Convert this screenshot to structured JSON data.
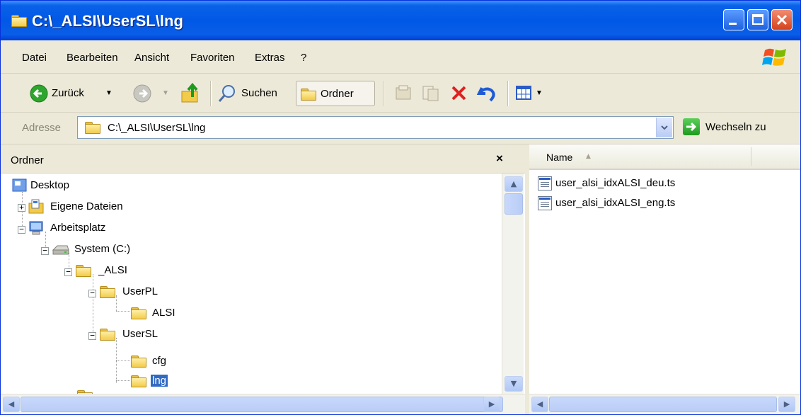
{
  "window": {
    "title": "C:\\_ALSI\\UserSL\\lng"
  },
  "menu": {
    "items": [
      "Datei",
      "Bearbeiten",
      "Ansicht",
      "Favoriten",
      "Extras",
      "?"
    ]
  },
  "toolbar": {
    "back_label": "Zurück",
    "search_label": "Suchen",
    "folders_label": "Ordner"
  },
  "address": {
    "label": "Adresse",
    "value": "C:\\_ALSI\\UserSL\\lng",
    "go_label": "Wechseln zu"
  },
  "folder_pane": {
    "title": "Ordner",
    "close": "×",
    "tree": [
      {
        "label": "Desktop"
      },
      {
        "label": "Eigene Dateien"
      },
      {
        "label": "Arbeitsplatz"
      },
      {
        "label": "System (C:)"
      },
      {
        "label": "_ALSI"
      },
      {
        "label": "UserPL"
      },
      {
        "label": "ALSI"
      },
      {
        "label": "UserSL"
      },
      {
        "label": "cfg"
      },
      {
        "label": "lng",
        "selected": true
      }
    ]
  },
  "file_pane": {
    "column_name": "Name",
    "files": [
      {
        "name": "user_alsi_idxALSI_deu.ts"
      },
      {
        "name": "user_alsi_idxALSI_eng.ts"
      }
    ]
  },
  "colors": {
    "titlebar": "#0058E6",
    "selection": "#316AC5",
    "chrome": "#ECE9D8"
  }
}
